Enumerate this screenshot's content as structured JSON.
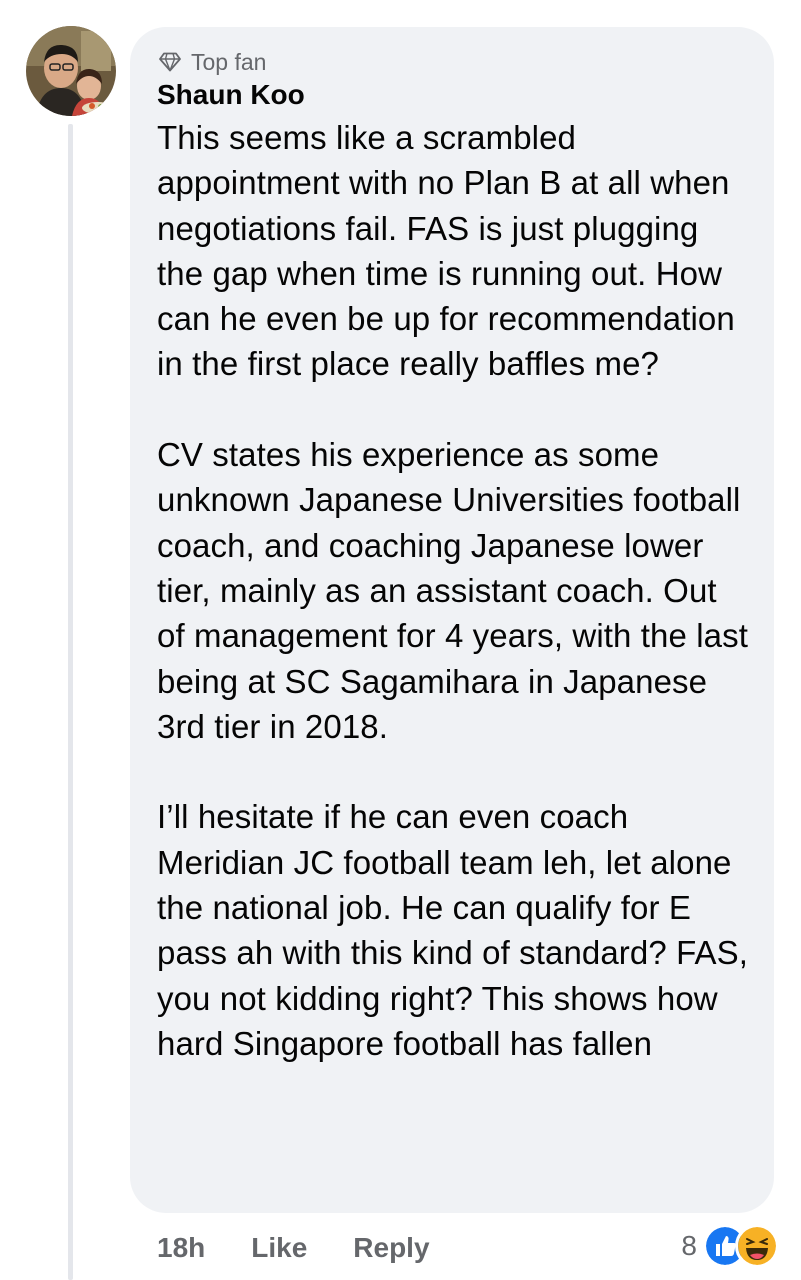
{
  "comment": {
    "badge": "Top fan",
    "author": "Shaun Koo",
    "paragraphs": [
      "This seems like a scrambled appointment with no Plan B at all when negotiations fail. FAS is just plugging the gap when time is running out. How can he even be up for recommendation in the first place really baffles me?",
      "CV states his experience as some unknown Japanese Universities football coach, and coaching Japanese lower tier, mainly as an assistant coach. Out of management for 4 years, with the last being at SC Sagamihara in Japanese 3rd tier in 2018.",
      "I’ll hesitate if he can even coach Meridian JC football team leh, let alone the national job. He can qualify for E pass ah with this kind of standard? FAS, you not kidding right? This shows how hard Singapore football has fallen"
    ]
  },
  "actions": {
    "time": "18h",
    "like_label": "Like",
    "reply_label": "Reply"
  },
  "reactions": {
    "count": "8",
    "icons": [
      "like-icon",
      "haha-icon"
    ]
  },
  "colors": {
    "bubble": "#f0f2f5",
    "secondary_text": "#65676b",
    "like_blue": "#1877f2",
    "haha_yellow": "#f7b125"
  }
}
